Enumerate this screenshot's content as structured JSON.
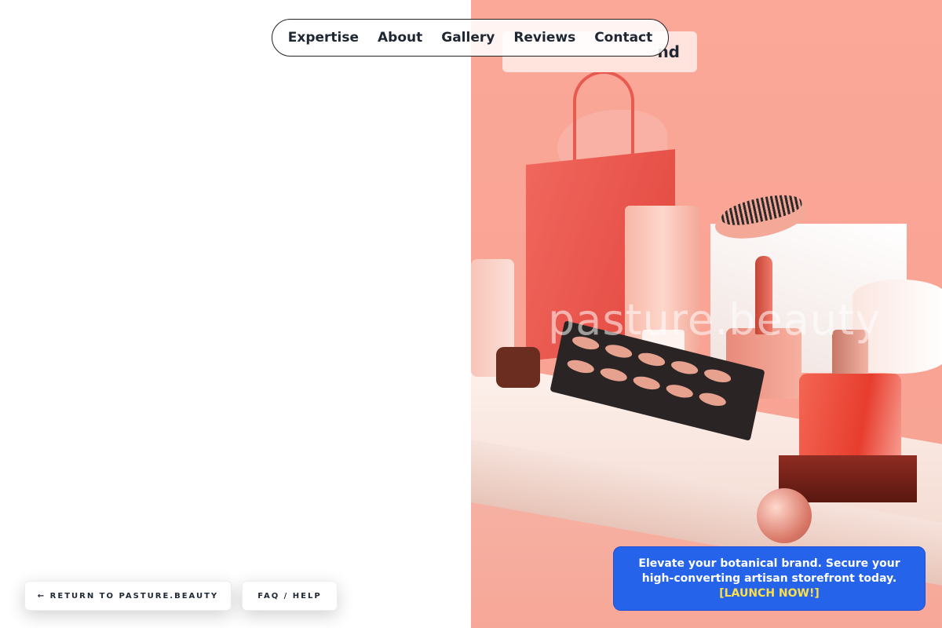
{
  "nav": {
    "items": [
      {
        "label": "Expertise"
      },
      {
        "label": "About"
      },
      {
        "label": "Gallery"
      },
      {
        "label": "Reviews"
      },
      {
        "label": "Contact"
      }
    ]
  },
  "hero": {
    "partial_heading": "nd",
    "watermark": "pasture.beauty"
  },
  "buttons": {
    "return_label": "← RETURN TO PASTURE.BEAUTY",
    "faq_label": "FAQ / HELP"
  },
  "promo": {
    "text": "Elevate your botanical brand. Secure your high-converting artisan storefront today.",
    "cta": "[LAUNCH NOW!]",
    "background": "#2563eb",
    "cta_color": "#fde047"
  },
  "colors": {
    "hero_bg": "#fba898"
  }
}
